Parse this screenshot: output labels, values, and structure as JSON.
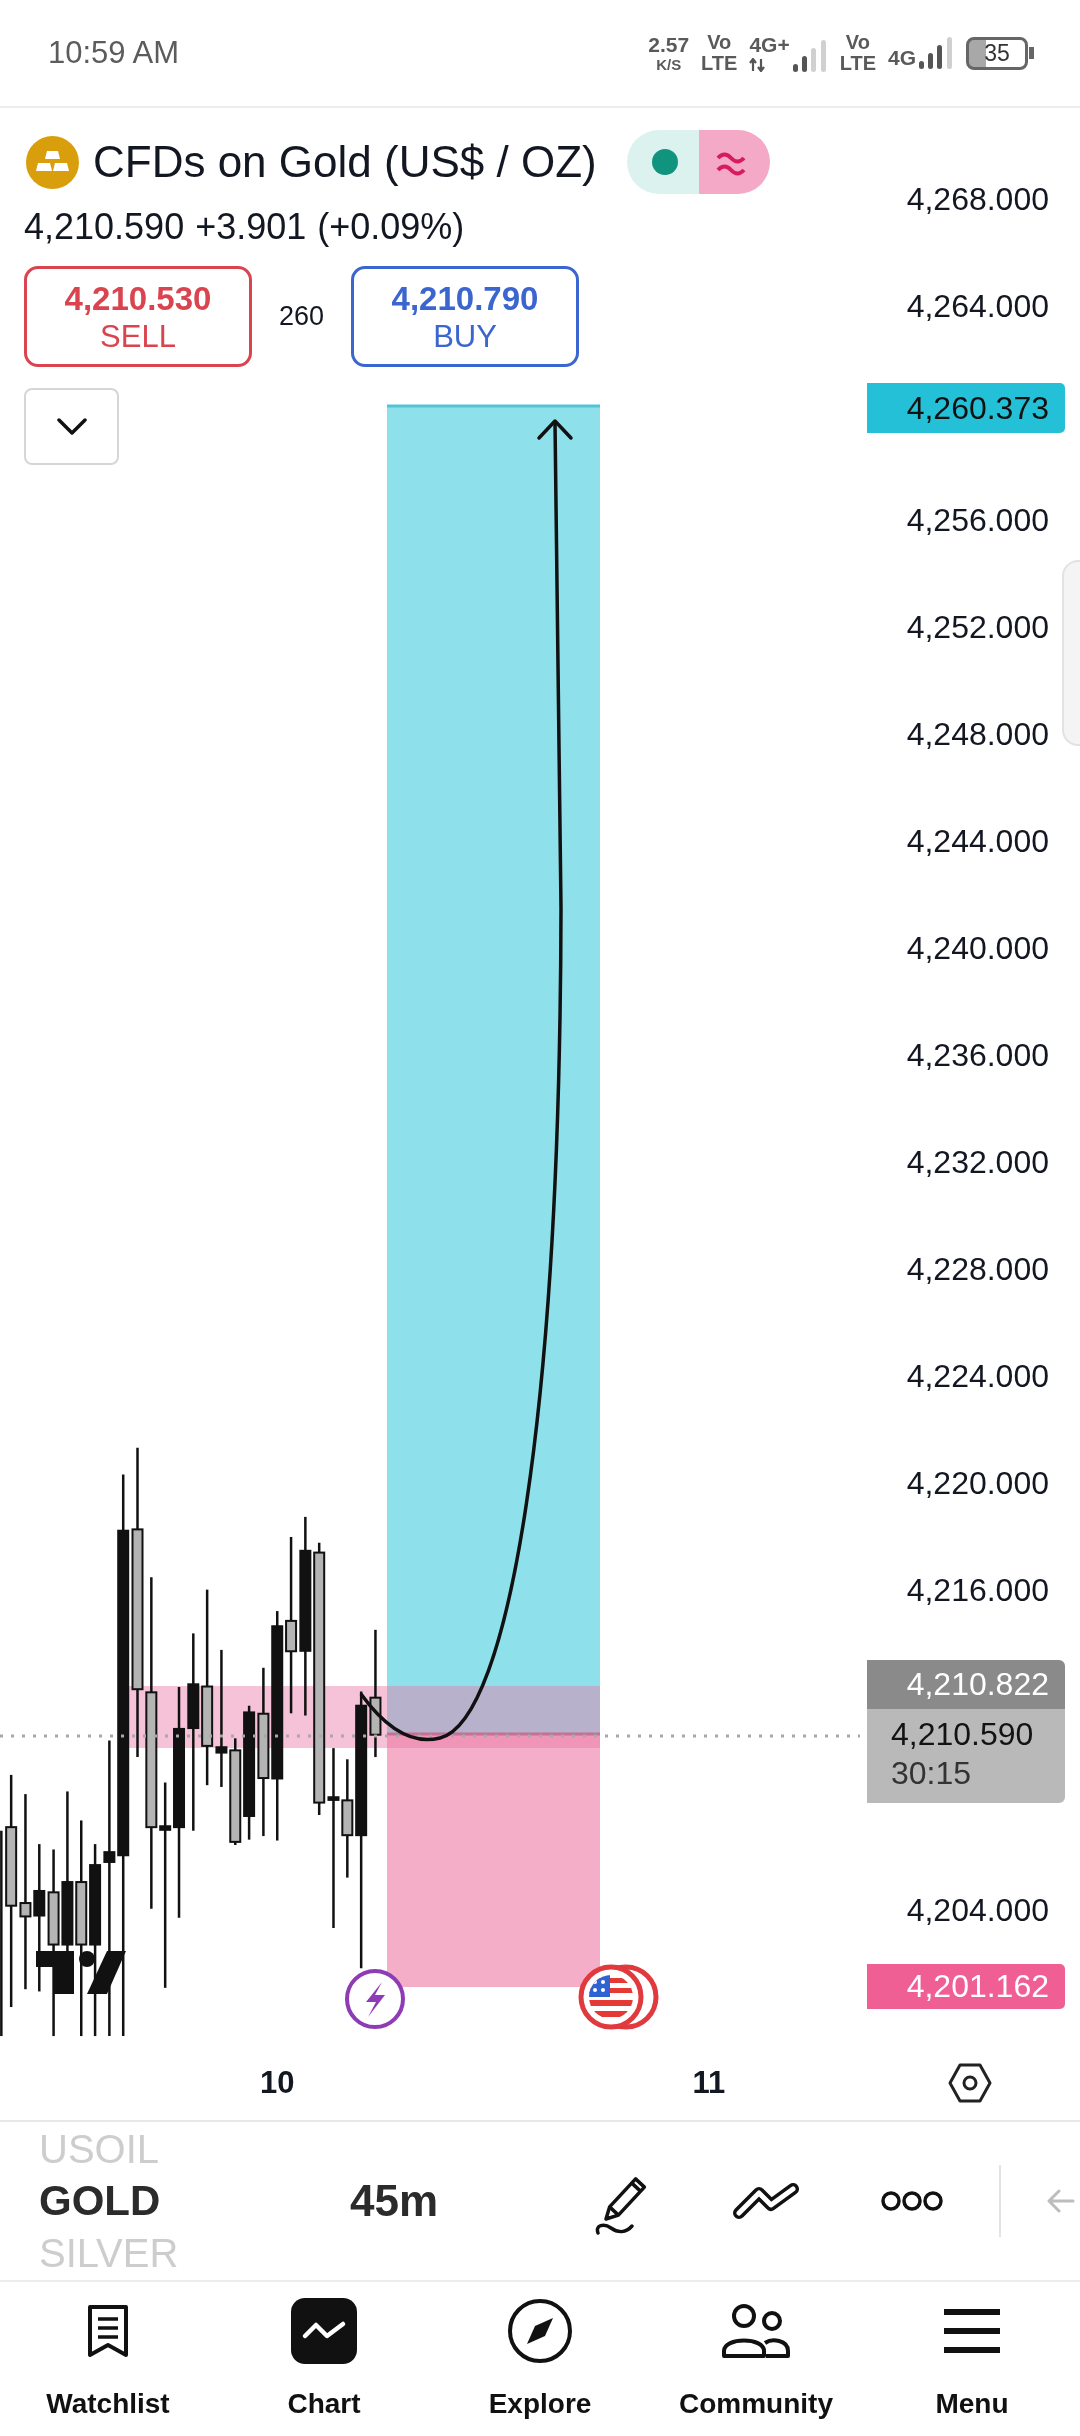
{
  "status_bar": {
    "time": "10:59 AM",
    "net_speed": "2.57",
    "net_unit": "K/S",
    "sims": [
      {
        "volte_top": "Vo",
        "volte_bottom": "LTE",
        "network": "4G+",
        "data_active": true
      },
      {
        "volte_top": "Vo",
        "volte_bottom": "LTE",
        "network": "4G",
        "data_active": false
      }
    ],
    "battery": "35"
  },
  "header": {
    "title": "CFDs on Gold (US$ / OZ)",
    "last_price": "4,210.590",
    "change": "+3.901",
    "change_percent": "(+0.09%)",
    "sell": {
      "price": "4,210.530",
      "label": "SELL"
    },
    "spread": "260",
    "buy": {
      "price": "4,210.790",
      "label": "BUY"
    }
  },
  "price_axis": [
    {
      "kind": "tick",
      "label": "4,268.000"
    },
    {
      "kind": "tick",
      "label": "4,264.000"
    },
    {
      "kind": "target",
      "label": "4,260.373"
    },
    {
      "kind": "tick",
      "label": "4,256.000"
    },
    {
      "kind": "tick",
      "label": "4,252.000"
    },
    {
      "kind": "tick",
      "label": "4,248.000"
    },
    {
      "kind": "tick",
      "label": "4,244.000"
    },
    {
      "kind": "tick",
      "label": "4,240.000"
    },
    {
      "kind": "tick",
      "label": "4,236.000"
    },
    {
      "kind": "tick",
      "label": "4,232.000"
    },
    {
      "kind": "tick",
      "label": "4,228.000"
    },
    {
      "kind": "tick",
      "label": "4,224.000"
    },
    {
      "kind": "tick",
      "label": "4,220.000"
    },
    {
      "kind": "tick",
      "label": "4,216.000"
    },
    {
      "kind": "last",
      "label": "4,210.822"
    },
    {
      "kind": "current",
      "label": "4,210.590",
      "countdown": "30:15"
    },
    {
      "kind": "tick",
      "label": "4,204.000"
    },
    {
      "kind": "stop",
      "label": "4,201.162"
    }
  ],
  "time_axis": [
    "10",
    "11"
  ],
  "toolbar": {
    "symbols": [
      {
        "label": "USOIL",
        "selected": false
      },
      {
        "label": "GOLD",
        "selected": true
      },
      {
        "label": "SILVER",
        "selected": false
      }
    ],
    "interval": "45m"
  },
  "bottom_nav": [
    {
      "label": "Watchlist",
      "selected": false
    },
    {
      "label": "Chart",
      "selected": true
    },
    {
      "label": "Explore",
      "selected": false
    },
    {
      "label": "Community",
      "selected": false
    },
    {
      "label": "Menu",
      "selected": false
    }
  ]
}
